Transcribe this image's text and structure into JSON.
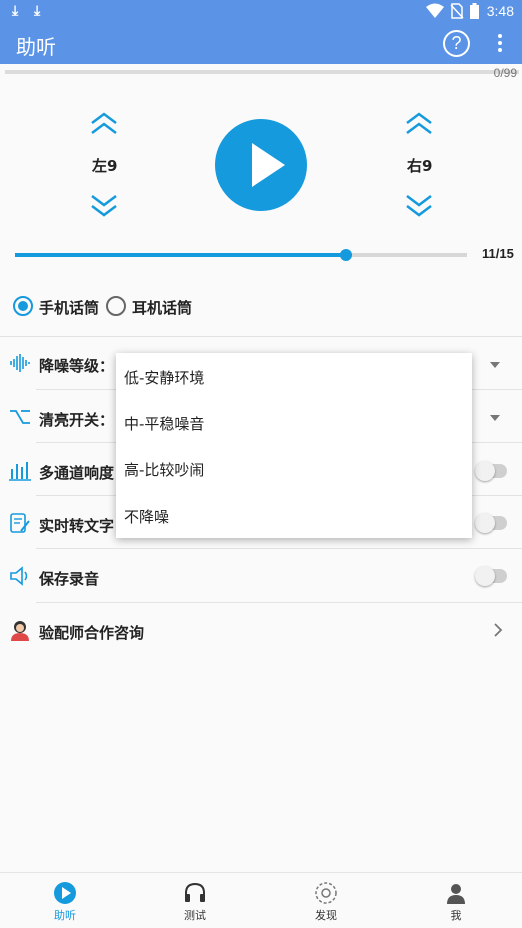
{
  "status_bar": {
    "time": "3:48"
  },
  "app_bar": {
    "title": "助听",
    "help_label": "?"
  },
  "progress": {
    "text": "0/99",
    "value": 0
  },
  "volume": {
    "left_label": "左9",
    "right_label": "右9"
  },
  "slider": {
    "text": "11/15",
    "fraction": 0.733
  },
  "microphone": {
    "options": [
      {
        "label": "手机话筒",
        "selected": true
      },
      {
        "label": "耳机话筒",
        "selected": false
      }
    ]
  },
  "settings": {
    "noise_level": "降噪等级：",
    "brightness_switch": "清亮开关：",
    "multichannel": "多通道响度",
    "transcribe": "实时转文字",
    "save_recording": "保存录音",
    "consult": "验配师合作咨询"
  },
  "dropdown": {
    "options": [
      "低-安静环境",
      "中-平稳噪音",
      "高-比较吵闹",
      "不降噪"
    ]
  },
  "bottom_nav": {
    "tabs": [
      {
        "label": "助听",
        "icon": "play-circle-icon",
        "active": true
      },
      {
        "label": "测试",
        "icon": "headphones-icon",
        "active": false
      },
      {
        "label": "发现",
        "icon": "discover-icon",
        "active": false
      },
      {
        "label": "我",
        "icon": "person-icon",
        "active": false
      }
    ]
  },
  "colors": {
    "primary": "#5b93e6",
    "accent": "#149add"
  }
}
